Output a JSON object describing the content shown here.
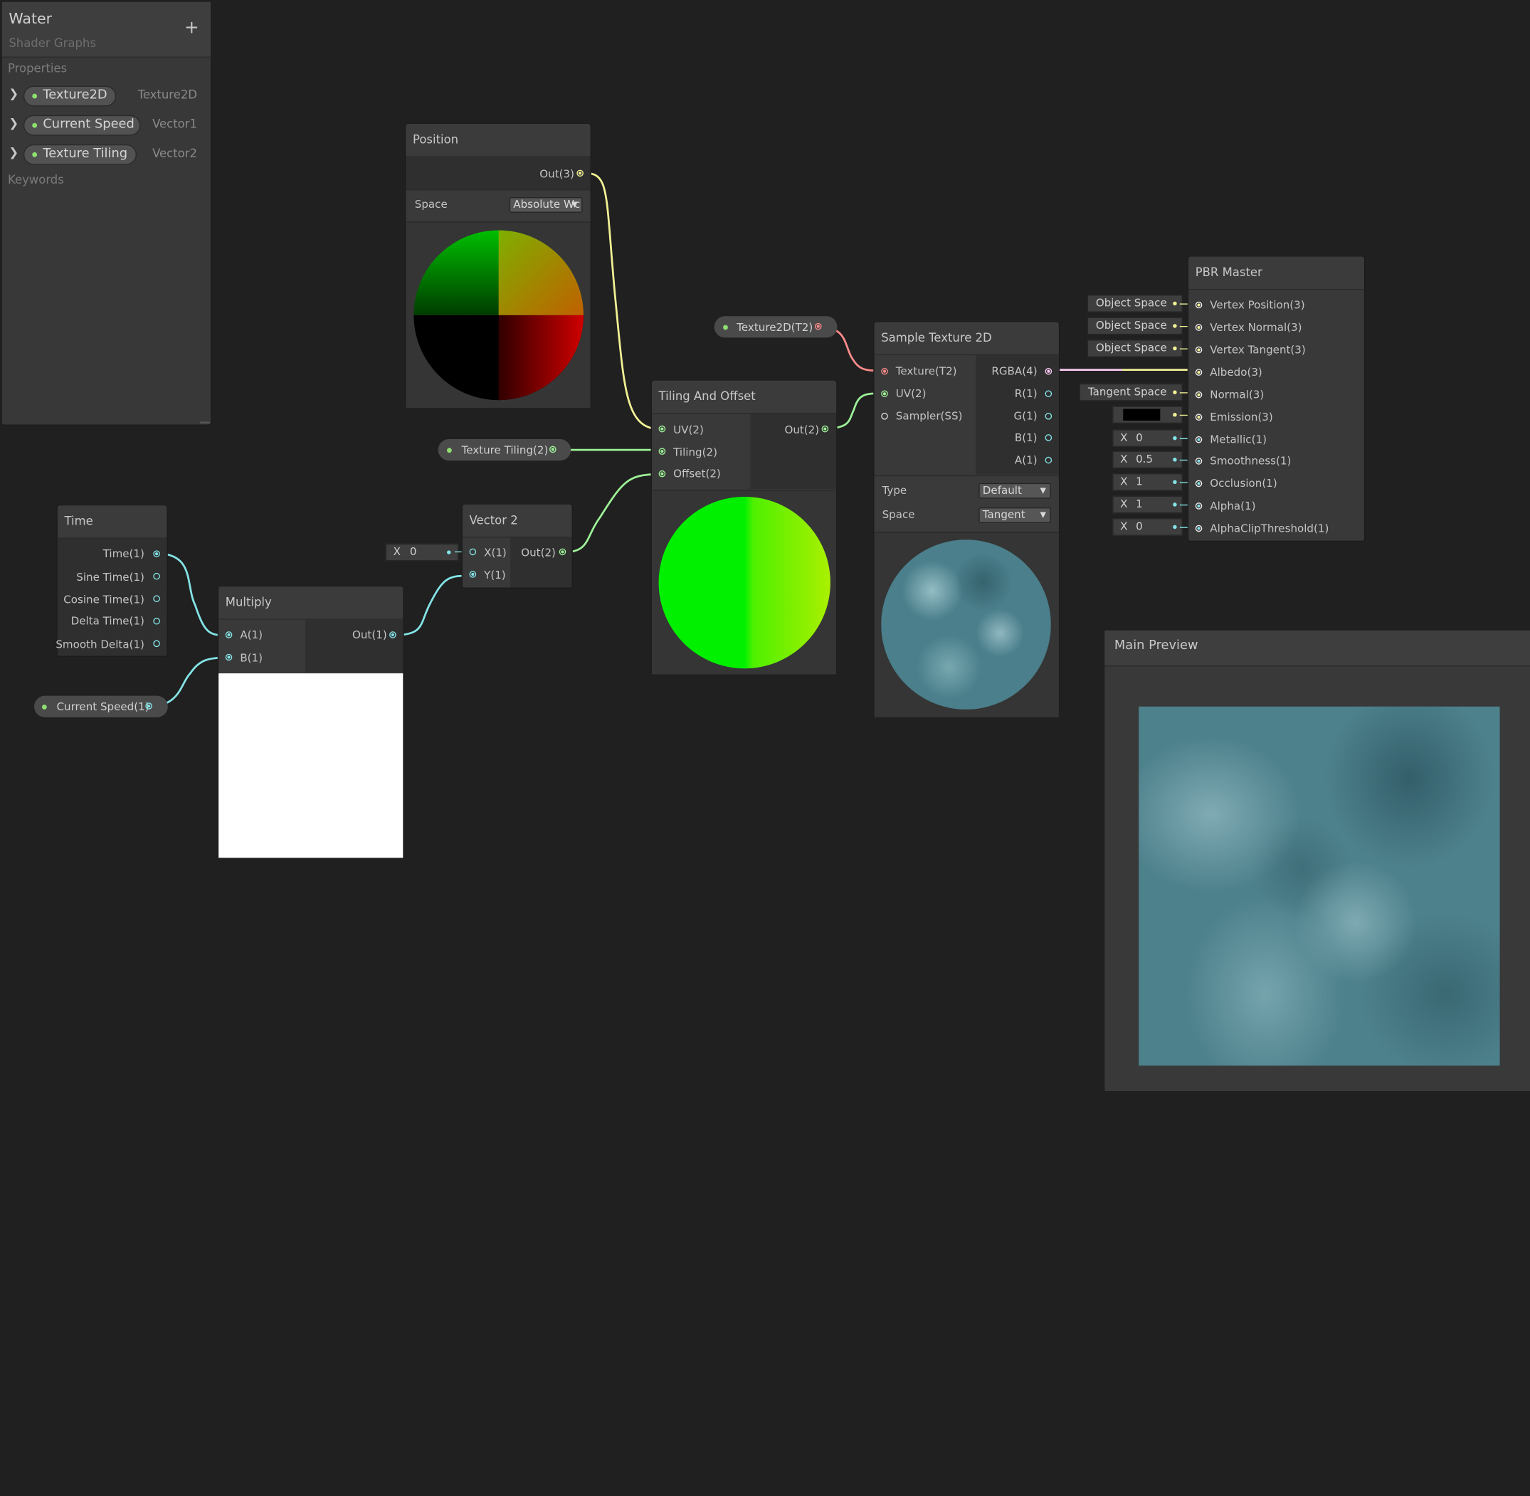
{
  "blackboard": {
    "title": "Water",
    "subtitle": "Shader Graphs",
    "add_icon": "+",
    "properties_label": "Properties",
    "keywords_label": "Keywords",
    "properties": [
      {
        "name": "Texture2D",
        "type": "Texture2D"
      },
      {
        "name": "Current Speed",
        "type": "Vector1"
      },
      {
        "name": "Texture Tiling",
        "type": "Vector2"
      }
    ]
  },
  "colors": {
    "vector3_wire": "#f1f195",
    "vector2_wire": "#9df197",
    "vector1_wire": "#84e4e7",
    "texture_wire": "#ff8b8b",
    "vector4_wire": "#fbcbf4",
    "background": "#202020"
  },
  "position_node": {
    "title": "Position",
    "out": "Out(3)",
    "space_label": "Space",
    "space_value": "Absolute Wc"
  },
  "time_node": {
    "title": "Time",
    "outputs": [
      "Time(1)",
      "Sine Time(1)",
      "Cosine Time(1)",
      "Delta Time(1)",
      "Smooth Delta(1)"
    ]
  },
  "multiply_node": {
    "title": "Multiply",
    "in_a": "A(1)",
    "in_b": "B(1)",
    "out": "Out(1)"
  },
  "vector2_node": {
    "title": "Vector 2",
    "in_x": "X(1)",
    "in_y": "Y(1)",
    "out": "Out(2)",
    "x_field_label": "X",
    "x_field_value": "0"
  },
  "tiling_node": {
    "title": "Tiling And Offset",
    "in_uv": "UV(2)",
    "in_tiling": "Tiling(2)",
    "in_offset": "Offset(2)",
    "out": "Out(2)"
  },
  "sample_node": {
    "title": "Sample Texture 2D",
    "inputs": [
      "Texture(T2)",
      "UV(2)",
      "Sampler(SS)"
    ],
    "outputs": [
      "RGBA(4)",
      "R(1)",
      "G(1)",
      "B(1)",
      "A(1)"
    ],
    "type_label": "Type",
    "type_value": "Default",
    "space_label": "Space",
    "space_value": "Tangent"
  },
  "property_nodes": {
    "texture2d": "Texture2D(T2)",
    "texture_tiling": "Texture Tiling(2)",
    "current_speed": "Current Speed(1)"
  },
  "pbr_node": {
    "title": "PBR Master",
    "inputs": [
      "Vertex Position(3)",
      "Vertex Normal(3)",
      "Vertex Tangent(3)",
      "Albedo(3)",
      "Normal(3)",
      "Emission(3)",
      "Metallic(1)",
      "Smoothness(1)",
      "Occlusion(1)",
      "Alpha(1)",
      "AlphaClipThreshold(1)"
    ],
    "defaults": {
      "vertex_position": "Object Space",
      "vertex_normal": "Object Space",
      "vertex_tangent": "Object Space",
      "normal": "Tangent Space",
      "emission_color": "#000000",
      "x_label": "X",
      "metallic": "0",
      "smoothness": "0.5",
      "occlusion": "1",
      "alpha": "1",
      "alpha_clip": "0"
    }
  },
  "main_preview": {
    "title": "Main Preview"
  }
}
